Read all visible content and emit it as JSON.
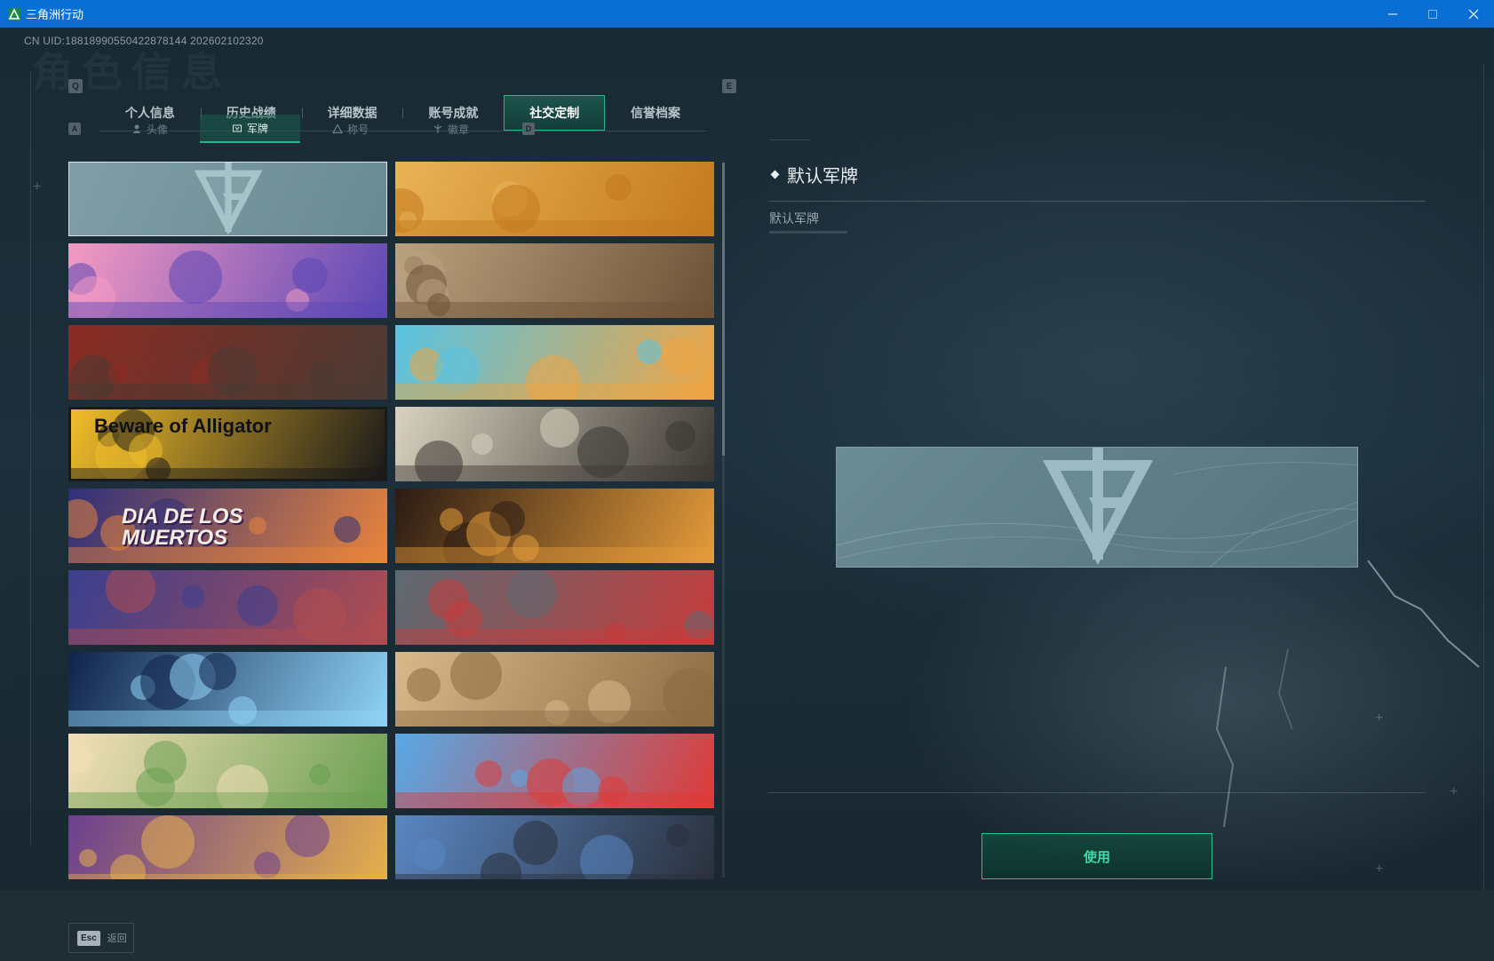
{
  "window": {
    "title": "三角洲行动"
  },
  "header": {
    "uid": "CN UID:18818990550422878144 202602102320",
    "ghost_title": "角色信息"
  },
  "main_tabs": {
    "prev_key": "Q",
    "next_key": "E",
    "items": [
      {
        "label": "个人信息",
        "active": false
      },
      {
        "label": "历史战绩",
        "active": false
      },
      {
        "label": "详细数据",
        "active": false
      },
      {
        "label": "账号成就",
        "active": false
      },
      {
        "label": "社交定制",
        "active": true
      },
      {
        "label": "信誉档案",
        "active": false
      }
    ]
  },
  "sub_tabs": {
    "prev_key": "A",
    "next_key": "D",
    "items": [
      {
        "label": "头像",
        "icon": "person-icon",
        "active": false
      },
      {
        "label": "军牌",
        "icon": "badge-icon",
        "active": true
      },
      {
        "label": "称号",
        "icon": "triangle-icon",
        "active": false
      },
      {
        "label": "徽章",
        "icon": "emblem-icon",
        "active": false
      }
    ]
  },
  "grid": {
    "cards": [
      {
        "theme": "default",
        "text": "",
        "colors": [
          "#7f9ea6",
          "#6a8a93"
        ],
        "selected": true
      },
      {
        "theme": "desert-surreal",
        "text": "",
        "colors": [
          "#e9b355",
          "#c3791f"
        ]
      },
      {
        "theme": "pink-train",
        "text": "",
        "colors": [
          "#f49ac2",
          "#5b47b5"
        ]
      },
      {
        "theme": "western-town",
        "text": "",
        "colors": [
          "#b9a27f",
          "#6d5137"
        ]
      },
      {
        "theme": "soldiers-red",
        "text": "",
        "colors": [
          "#8a2b23",
          "#4a3b34"
        ]
      },
      {
        "theme": "beach-bbq",
        "text": "",
        "colors": [
          "#58c4e3",
          "#f0a441"
        ]
      },
      {
        "theme": "beware-alligator",
        "text": "Beware of Alligator",
        "colors": [
          "#f1bd2a",
          "#1a1a1a"
        ]
      },
      {
        "theme": "knight-windmill",
        "text": "",
        "colors": [
          "#d9d2c0",
          "#3b3834"
        ]
      },
      {
        "theme": "dia-de-los-muertos",
        "text": "DIA DE LOS MUERTOS",
        "colors": [
          "#2e2f7a",
          "#e8843c"
        ]
      },
      {
        "theme": "candle-swan",
        "text": "",
        "colors": [
          "#2a1b14",
          "#e59c3a"
        ]
      },
      {
        "theme": "graveyard",
        "text": "",
        "colors": [
          "#3a3f8f",
          "#b04c4f"
        ]
      },
      {
        "theme": "pixel-game",
        "text": "",
        "colors": [
          "#5c6a72",
          "#c63b3b"
        ]
      },
      {
        "theme": "skeleton-space",
        "text": "",
        "colors": [
          "#10234a",
          "#8fd3f5"
        ]
      },
      {
        "theme": "parchment-mech",
        "text": "",
        "colors": [
          "#d7b98a",
          "#8b6b42"
        ]
      },
      {
        "theme": "kitchen-chibi",
        "text": "",
        "colors": [
          "#f3dfb8",
          "#6a9f52"
        ]
      },
      {
        "theme": "fries-mascot",
        "text": "",
        "colors": [
          "#57a9e6",
          "#e03a36"
        ]
      },
      {
        "theme": "party-chibi",
        "text": "",
        "colors": [
          "#6b3f8f",
          "#e6b14a"
        ]
      },
      {
        "theme": "stadium-archer",
        "text": "",
        "colors": [
          "#5a86c2",
          "#2a2f3a"
        ]
      }
    ]
  },
  "detail": {
    "title": "默认军牌",
    "description": "默认军牌",
    "use_button": "使用"
  },
  "bottom": {
    "esc_key": "Esc",
    "back_label": "返回"
  }
}
